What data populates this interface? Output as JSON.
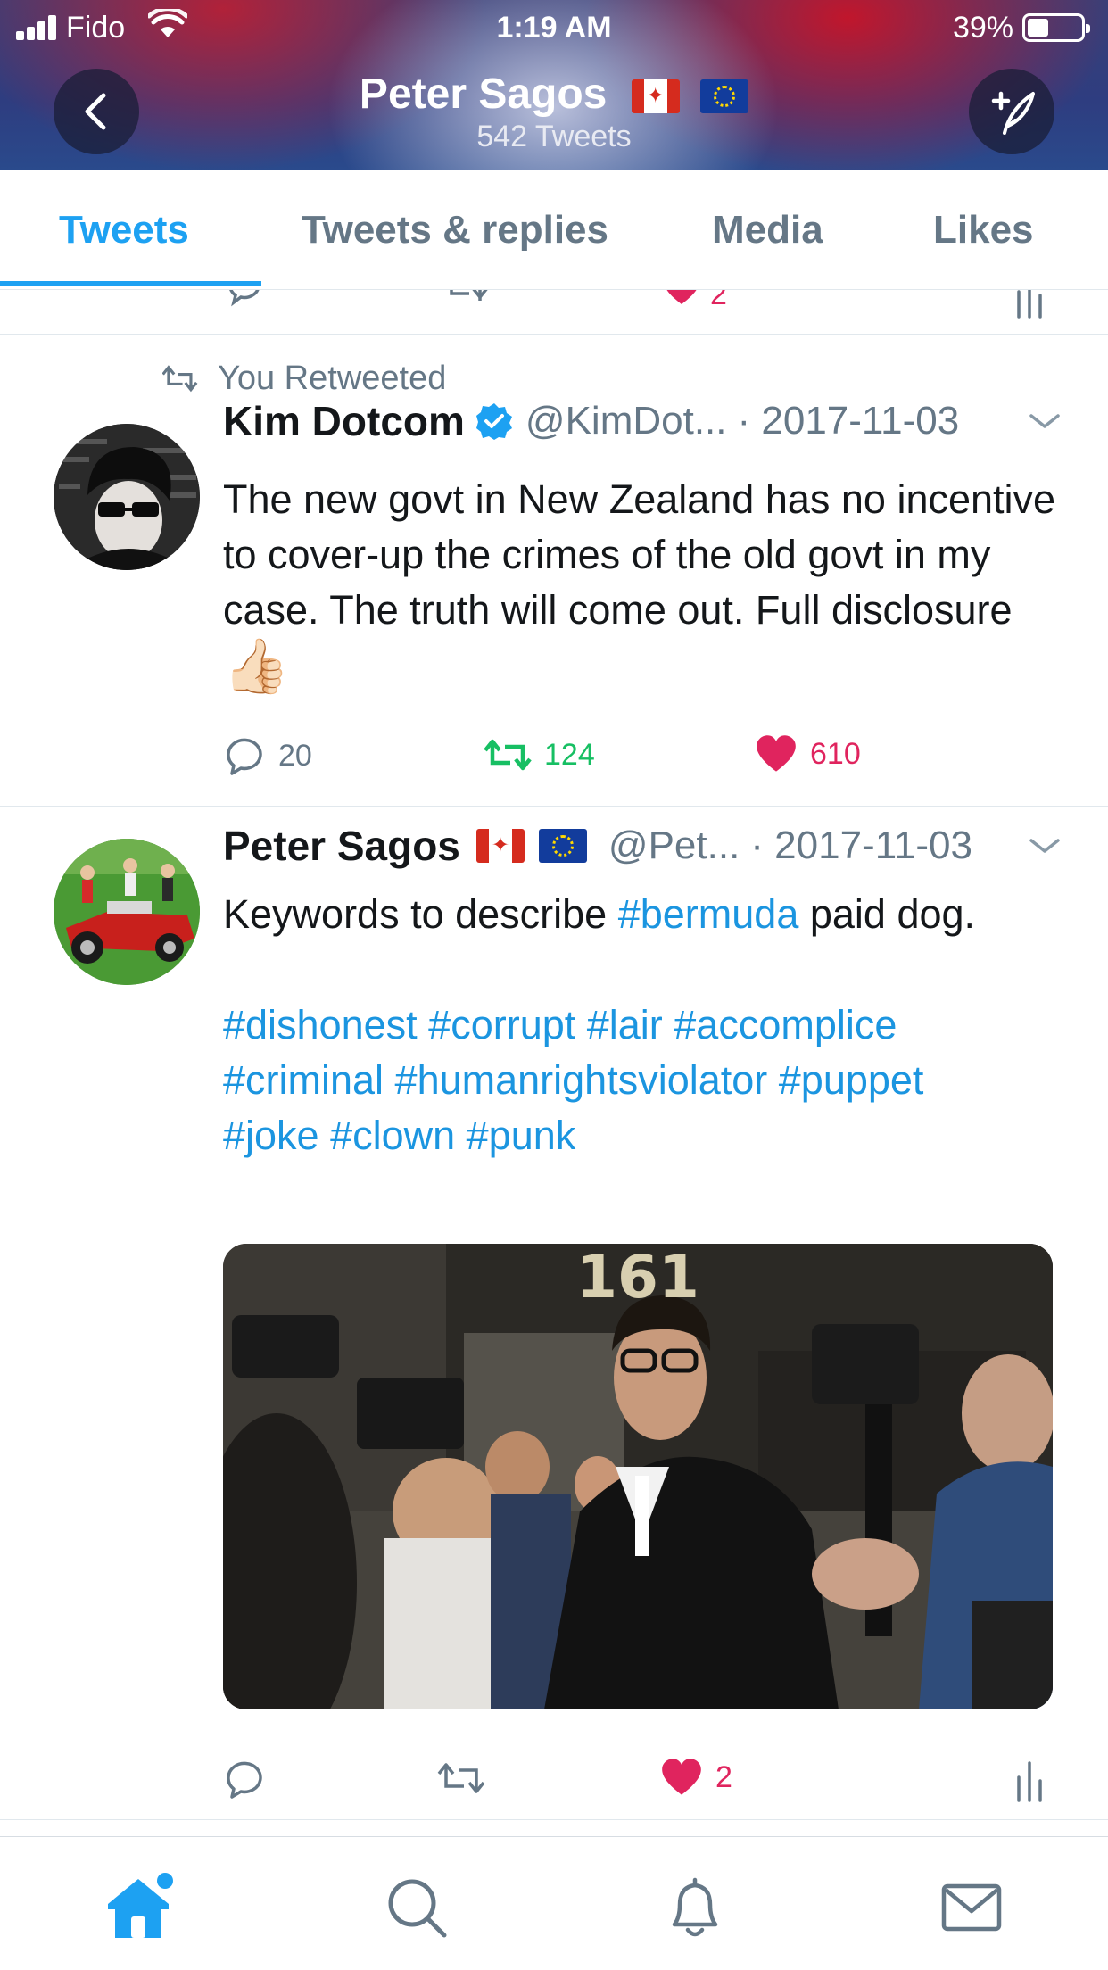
{
  "status_bar": {
    "carrier": "Fido",
    "time": "1:19 AM",
    "battery": "39%",
    "battery_level": 0.39
  },
  "header": {
    "title": "Peter Sagos",
    "tweet_count": "542 Tweets",
    "flags": [
      "flag-canada",
      "flag-eu"
    ]
  },
  "tabs": [
    {
      "label": "Tweets",
      "active": true
    },
    {
      "label": "Tweets & replies",
      "active": false
    },
    {
      "label": "Media",
      "active": false
    },
    {
      "label": "Likes",
      "active": false
    }
  ],
  "partial_row": {
    "like_count": "2"
  },
  "tweets": [
    {
      "context": "You Retweeted",
      "name": "Kim Dotcom",
      "verified": true,
      "handle": "@KimDot...",
      "date": "· 2017-11-03",
      "text": "The new govt in New Zealand has no incentive to cover-up the crimes of the old govt in my case. The truth will come out. Full disclosure",
      "emoji": "👍🏻",
      "replies": "20",
      "retweets": "124",
      "likes": "610",
      "retweeted": true,
      "liked": true
    },
    {
      "name": "Peter Sagos",
      "handle": "@Pet...",
      "date": "· 2017-11-03",
      "text_before": "Keywords to describe ",
      "hashtag_inline": "#bermuda",
      "text_after": " paid dog.",
      "hashtags_line1": "#dishonest #corrupt #lair #accomplice",
      "hashtags_line2": "#criminal #humanrightsviolator #puppet",
      "hashtags_line3": "#joke #clown #punk",
      "media_text": "161",
      "likes": "2",
      "liked": true
    }
  ],
  "bottom_nav": [
    {
      "icon": "home-icon",
      "active": true,
      "badge": true
    },
    {
      "icon": "search-icon",
      "active": false
    },
    {
      "icon": "bell-icon",
      "active": false
    },
    {
      "icon": "mail-icon",
      "active": false
    }
  ],
  "colors": {
    "accent": "#1da1f2",
    "hashtag": "#1b95e0",
    "like": "#e0245e",
    "retweet": "#17bf63",
    "muted": "#657786"
  }
}
